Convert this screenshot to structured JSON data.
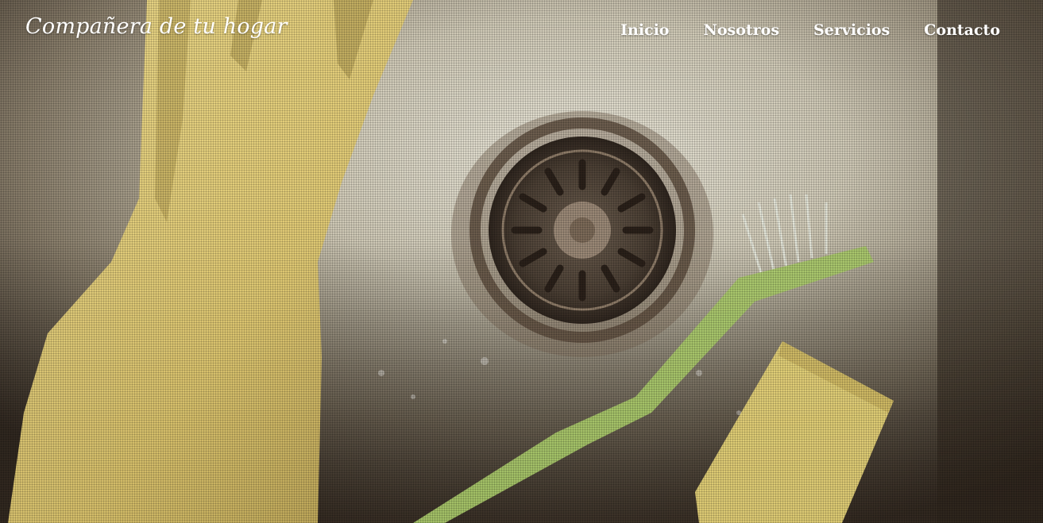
{
  "site": {
    "logo": "Compañera de tu hogar"
  },
  "nav": {
    "items": [
      {
        "label": "Inicio"
      },
      {
        "label": "Nosotros"
      },
      {
        "label": "Servicios"
      },
      {
        "label": "Contacto"
      }
    ]
  },
  "hero": {
    "background": "photo of a stainless sink drain with yellow rubber glove, green brush and yellow sponge"
  },
  "colors": {
    "nav_text": "#ffffff",
    "sink_metal": "#cfcab8",
    "glove_yellow": "#e9d27a",
    "brush_green": "#a9c86a",
    "sponge_yellow": "#e6d378",
    "shadow_brown": "#4a4035"
  }
}
